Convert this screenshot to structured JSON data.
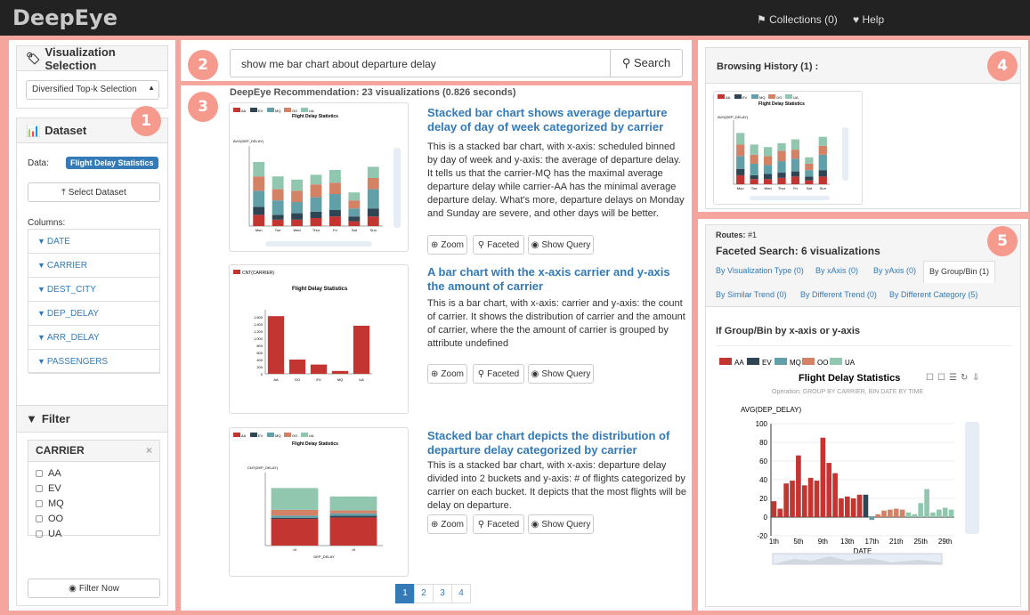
{
  "app": {
    "brand": "DeepEye",
    "collections": "Collections (0)",
    "help": "Help"
  },
  "badges": [
    "1",
    "2",
    "3",
    "4",
    "5"
  ],
  "sidebar": {
    "vis_selection_title": "Visualization Selection",
    "vis_selection_value": "Diversified Top-k Selection",
    "dataset_title": "Dataset",
    "data_label": "Data:",
    "data_value": "Flight Delay Statistics",
    "select_dataset": "Select Dataset",
    "columns_label": "Columns:",
    "columns": [
      "DATE",
      "CARRIER",
      "DEST_CITY",
      "DEP_DELAY",
      "ARR_DELAY",
      "PASSENGERS"
    ],
    "filter_title": "Filter",
    "filter_box_title": "CARRIER",
    "filter_close": "×",
    "filter_options": [
      "AA",
      "EV",
      "MQ",
      "OO",
      "UA"
    ],
    "filter_now": "Filter Now"
  },
  "search": {
    "query": "show me bar chart about departure delay",
    "button": "Search"
  },
  "results": {
    "header": "DeepEye Recommendation: 23 visualizations (0.826 seconds)",
    "items": [
      {
        "title": "Stacked bar chart shows average departure delay of day of week categorized by carrier",
        "text": "This is a stacked bar chart, with x-axis: scheduled binned by day of week and y-axis: the average of departure delay. It tells us that the carrier-MQ has the maximal average departure delay while carrier-AA has the minimal average departure delay. What's more, departure delays on Monday and Sunday are severe, and other days will be better."
      },
      {
        "title": "A bar chart with the x-axis carrier and y-axis the amount of carrier",
        "text": "This is a bar chart, with x-axis: carrier and y-axis: the count of carrier. It shows the distribution of carrier and the amount of carrier, where the the amount of carrier is grouped by attribute undefined"
      },
      {
        "title": "Stacked bar chart depicts the distribution of departure delay categorized by carrier",
        "text": "This is a stacked bar chart, with x-axis: departure delay divided into 2 buckets and y-axis: # of flights categorized by carrier on each bucket. It depicts that the most flights will be delay on departure."
      }
    ],
    "buttons": {
      "zoom": "Zoom",
      "faceted": "Faceted",
      "show_query": "Show Query"
    },
    "pages": [
      "1",
      "2",
      "3",
      "4"
    ]
  },
  "history": {
    "title": "Browsing History (1) :"
  },
  "faceted": {
    "routes_label": "Routes:",
    "routes_value": "#1",
    "title": "Faceted Search: 6 visualizations",
    "tabs": [
      "By Visualization Type (0)",
      "By xAxis (0)",
      "By yAxis (0)",
      "By Group/Bin (1)",
      "By Similar Trend (0)",
      "By Different Trend (0)",
      "By Different Category (5)"
    ],
    "subtitle": "If Group/Bin by x-axis or y-axis"
  },
  "colors": {
    "AA": "#c23531",
    "EV": "#2f4554",
    "MQ": "#61a0a8",
    "OO": "#d48265",
    "UA": "#91c7ae",
    "accent": "#337ab7",
    "frame": "#f3a59e",
    "badge": "#f69a8d"
  },
  "chart_data": [
    {
      "type": "bar",
      "title": "Flight Delay Statistics",
      "subtitle": "Operation: GROUP BY CARRIER, BIN DATE BY TIME",
      "legend": [
        "AA",
        "EV",
        "MQ",
        "OO",
        "UA"
      ],
      "ylabel": "AVG(DEP_DELAY)",
      "xlabel": "DATE",
      "ylim": [
        -20,
        100
      ],
      "yticks": [
        -20,
        0,
        20,
        40,
        60,
        80,
        100
      ],
      "xticks": [
        "1th",
        "5th",
        "9th",
        "13th",
        "17th",
        "21th",
        "25th",
        "29th"
      ],
      "series": [
        {
          "name": "AA",
          "x": [
            1,
            2,
            3,
            4,
            5,
            6,
            7,
            8,
            9,
            10,
            11,
            12,
            13,
            14,
            15
          ],
          "values": [
            17,
            9,
            36,
            39,
            66,
            34,
            42,
            39,
            85,
            58,
            47,
            20,
            22,
            20,
            24
          ]
        },
        {
          "name": "EV",
          "x": [
            16
          ],
          "values": [
            24
          ]
        },
        {
          "name": "MQ",
          "x": [
            17
          ],
          "values": [
            -3
          ]
        },
        {
          "name": "OO",
          "x": [
            18,
            19,
            20,
            21,
            22
          ],
          "values": [
            3,
            7,
            8,
            9,
            8
          ]
        },
        {
          "name": "UA",
          "x": [
            23,
            24,
            25,
            26,
            27,
            28,
            29,
            30
          ],
          "values": [
            5,
            3,
            15,
            30,
            5,
            8,
            10,
            8
          ]
        }
      ]
    },
    {
      "type": "bar",
      "title": "Flight Delay Statistics",
      "legend": [
        "CNT(CARRIER)"
      ],
      "categories": [
        "AA",
        "OO",
        "EV",
        "MQ",
        "UA"
      ],
      "values": [
        1620,
        400,
        260,
        80,
        1350
      ]
    },
    {
      "type": "bar",
      "title": "Flight Delay Statistics",
      "legend": [
        "AA",
        "EV",
        "MQ",
        "OO",
        "UA"
      ],
      "ylabel": "CNT(DEP_DELAY)",
      "xlabel": "DEP_DELAY",
      "categories": [
        "<0",
        ">0"
      ],
      "series": [
        {
          "name": "AA",
          "values": [
            950,
            1000
          ]
        },
        {
          "name": "EV",
          "values": [
            40,
            60
          ]
        },
        {
          "name": "MQ",
          "values": [
            80,
            90
          ]
        },
        {
          "name": "OO",
          "values": [
            200,
            100
          ]
        },
        {
          "name": "UA",
          "values": [
            780,
            500
          ]
        }
      ]
    }
  ]
}
